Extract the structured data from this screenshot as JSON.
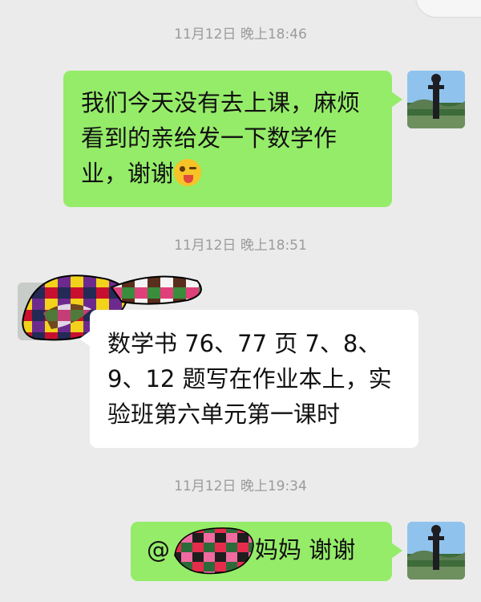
{
  "messages": [
    {
      "timestamp": "11月12日 晚上18:46",
      "sender": "me",
      "text": "我们今天没有去上课，麻烦看到的亲给发一下数学作业，谢谢",
      "emoji": "winking-tongue-emoji"
    },
    {
      "timestamp": "11月12日 晚上18:51",
      "sender": "other",
      "text": "数学书 76、77 页 7、8、9、12 题写在作业本上，实验班第六单元第一课时"
    },
    {
      "timestamp": "11月12日 晚上19:34",
      "sender": "me",
      "mention_prefix": "@",
      "text_suffix": "妈妈  谢谢"
    }
  ],
  "colors": {
    "background": "#ebebeb",
    "my_bubble": "#95ec69",
    "their_bubble": "#ffffff",
    "timestamp_text": "#9b9b9b"
  }
}
